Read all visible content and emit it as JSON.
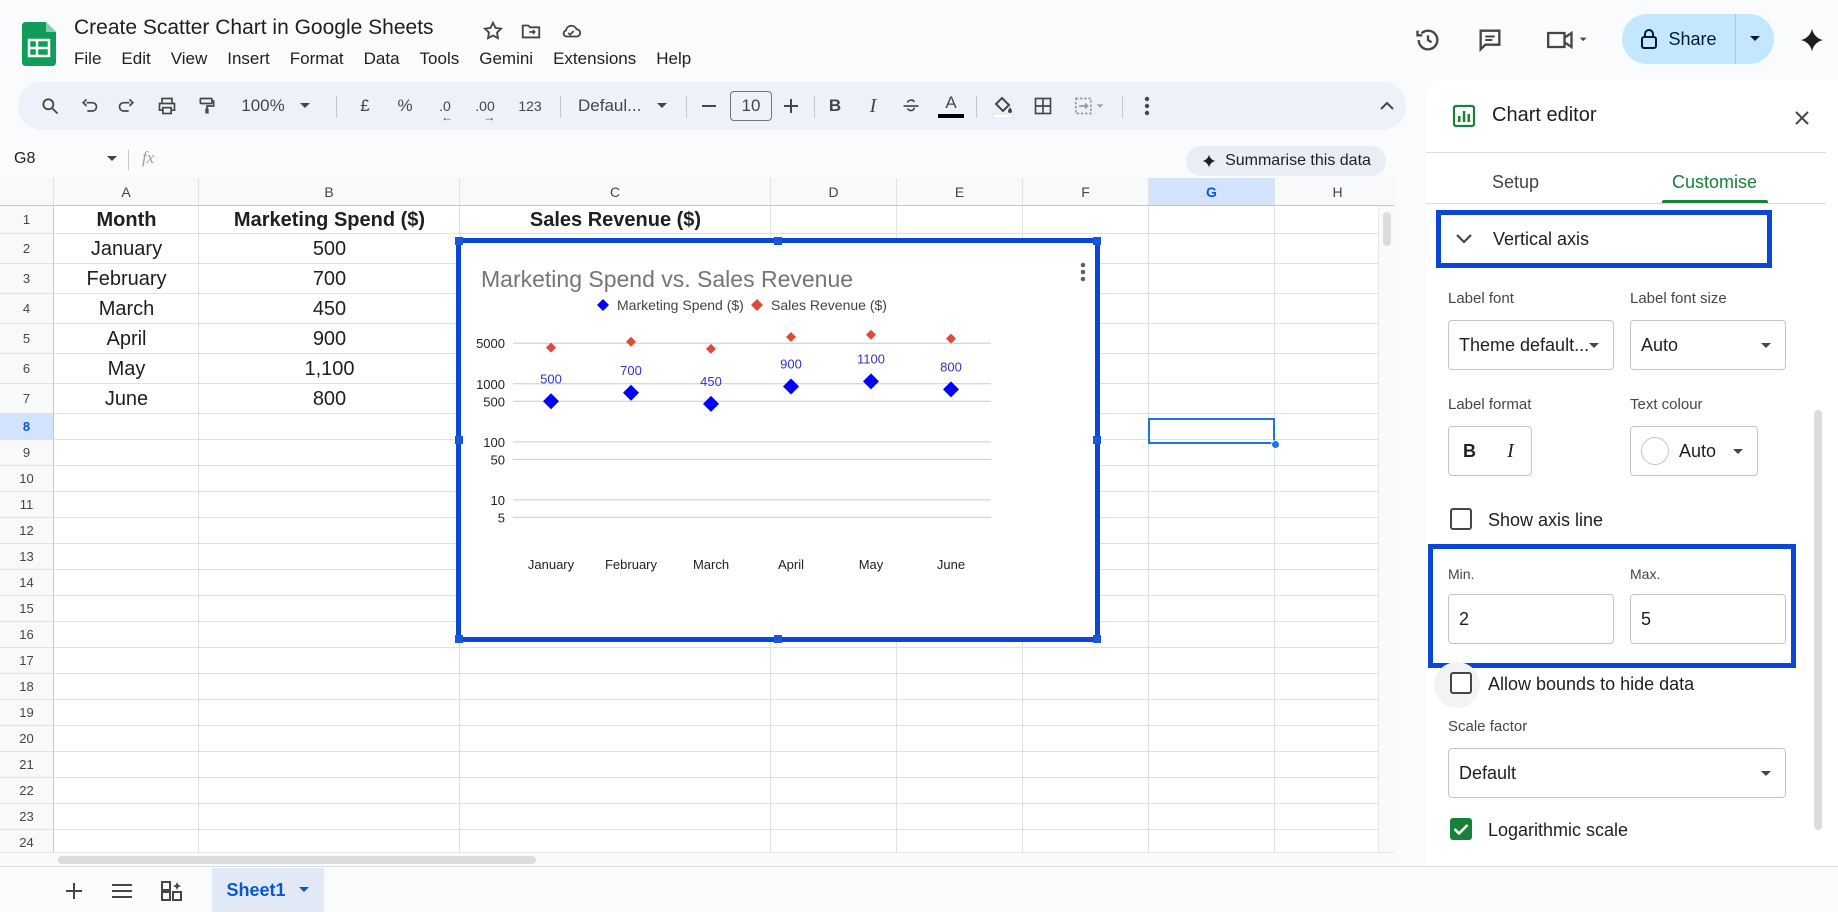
{
  "app": {
    "doc_title": "Create Scatter Chart in Google Sheets",
    "menu": [
      "File",
      "Edit",
      "View",
      "Insert",
      "Format",
      "Data",
      "Tools",
      "Gemini",
      "Extensions",
      "Help"
    ],
    "share_label": "Share"
  },
  "toolbar": {
    "zoom": "100%",
    "currency": "£",
    "percent": "%",
    "dec_decrease": ".0",
    "dec_increase": ".00",
    "number_format": "123",
    "font": "Defaul...",
    "font_size": "10",
    "bold": "B",
    "italic": "I",
    "text_color_glyph": "A"
  },
  "formula": {
    "namebox": "G8",
    "fx": "fx",
    "summarise_label": "Summarise this data"
  },
  "grid": {
    "columns": [
      "A",
      "B",
      "C",
      "D",
      "E",
      "F",
      "G",
      "H"
    ],
    "rows": [
      "1",
      "2",
      "3",
      "4",
      "5",
      "6",
      "7",
      "8",
      "9",
      "10",
      "11",
      "12",
      "13",
      "14",
      "15",
      "16",
      "17",
      "18",
      "19",
      "20",
      "21",
      "22",
      "23",
      "24"
    ],
    "headers": [
      "Month",
      "Marketing Spend ($)",
      "Sales Revenue ($)"
    ],
    "months": [
      "January",
      "February",
      "March",
      "April",
      "May",
      "June"
    ],
    "spend": [
      "500",
      "700",
      "450",
      "900",
      "1,100",
      "800"
    ]
  },
  "chart_data": {
    "type": "scatter",
    "title": "Marketing Spend vs. Sales Revenue",
    "categories": [
      "January",
      "February",
      "March",
      "April",
      "May",
      "June"
    ],
    "series": [
      {
        "name": "Marketing Spend ($)",
        "values": [
          500,
          700,
          450,
          900,
          1100,
          800
        ],
        "color": "#0000ff",
        "labels": [
          "500",
          "700",
          "450",
          "900",
          "1100",
          "800"
        ]
      },
      {
        "name": "Sales Revenue ($)",
        "values": [
          4200,
          5300,
          4000,
          6400,
          7000,
          6000
        ],
        "color": "#e04a3a"
      }
    ],
    "y_ticks": [
      "5000",
      "1000",
      "500",
      "100",
      "50",
      "10",
      "5"
    ],
    "y_tick_values": [
      5000,
      1000,
      500,
      100,
      50,
      10,
      5
    ],
    "y_scale": "log",
    "legend": "top",
    "grid": true
  },
  "editor": {
    "title": "Chart editor",
    "tabs": [
      "Setup",
      "Customise"
    ],
    "active_tab": "Customise",
    "section": "Vertical axis",
    "label_font_label": "Label font",
    "label_font_value": "Theme default...",
    "label_font_size_label": "Label font size",
    "label_font_size_value": "Auto",
    "label_format_label": "Label format",
    "text_colour_label": "Text colour",
    "text_colour_value": "Auto",
    "show_axis_line": "Show axis line",
    "min_label": "Min.",
    "min_value": "2",
    "max_label": "Max.",
    "max_value": "5",
    "allow_bounds": "Allow bounds to hide data",
    "scale_factor_label": "Scale factor",
    "scale_factor_value": "Default",
    "log_scale": "Logarithmic scale"
  },
  "sheets": {
    "active": "Sheet1"
  },
  "colors": {
    "accent_green": "#188038",
    "highlight_blue": "#0a47d6",
    "share_bg": "#c2e7ff"
  }
}
